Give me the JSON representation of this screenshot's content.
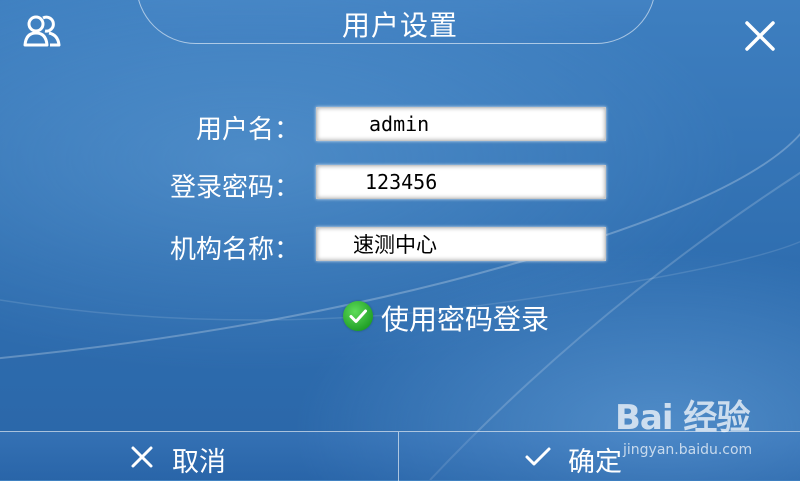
{
  "header": {
    "title": "用户设置",
    "user_icon": "users-icon",
    "close_icon": "close-icon"
  },
  "form": {
    "username": {
      "label": "用户名：",
      "value": "admin"
    },
    "password": {
      "label": "登录密码：",
      "value": "123456"
    },
    "organization": {
      "label": "机构名称：",
      "value": "速测中心"
    }
  },
  "options": {
    "use_password_login": {
      "label": "使用密码登录",
      "checked": true,
      "icon": "check-circle-icon",
      "color": "#2fb536"
    }
  },
  "footer": {
    "cancel": {
      "label": "取消",
      "icon": "x-icon"
    },
    "confirm": {
      "label": "确定",
      "icon": "checkmark-icon"
    }
  },
  "watermark": {
    "brand": "Bai 经验",
    "url": "jingyan.baidu.com"
  },
  "colors": {
    "background": "#2f6eb0",
    "text": "#ffffff",
    "input_bg": "#ffffff"
  }
}
